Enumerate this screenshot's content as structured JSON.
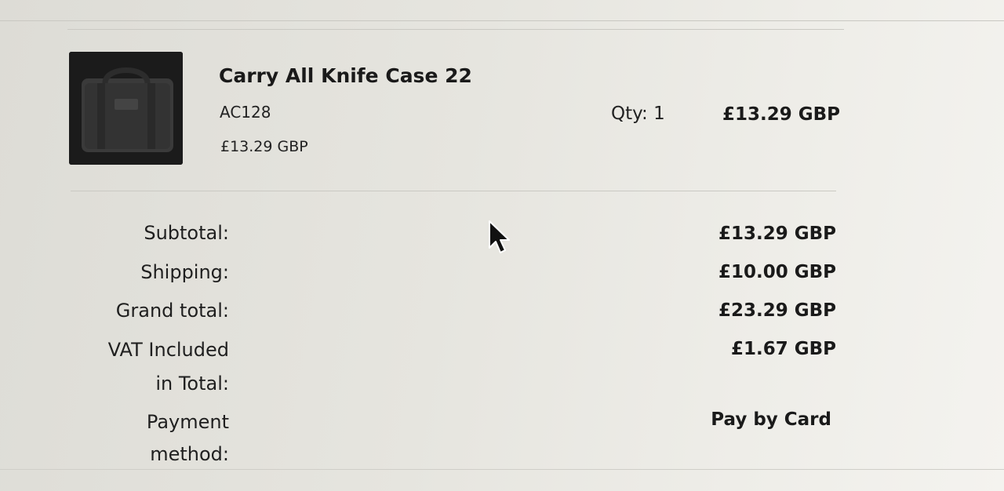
{
  "order_item": {
    "name": "Carry All Knife Case 22",
    "sku": "AC128",
    "unit_price": "£13.29 GBP",
    "qty_label": "Qty: 1",
    "line_total": "£13.29 GBP",
    "thumbnail_icon": "bag-icon"
  },
  "summary": {
    "subtotal_label": "Subtotal:",
    "subtotal_value": "£13.29 GBP",
    "shipping_label": "Shipping:",
    "shipping_value": "£10.00 GBP",
    "grand_total_label": "Grand total:",
    "grand_total_value": "£23.29 GBP",
    "vat_label_line1": "VAT Included",
    "vat_label_line2": "in Total:",
    "vat_value": "£1.67 GBP",
    "payment_label_line1": "Payment",
    "payment_label_line2": "method:",
    "payment_value": "Pay by Card"
  },
  "cursor_icon": "mouse-pointer-icon"
}
